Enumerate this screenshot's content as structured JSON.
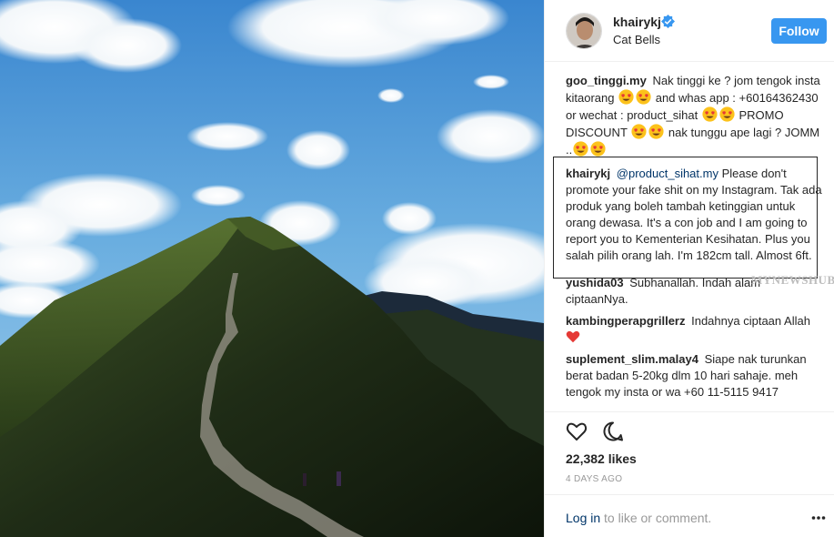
{
  "post": {
    "username": "khairykj",
    "location": "Cat Bells",
    "follow_label": "Follow",
    "verified_icon": "verified-badge-icon"
  },
  "comments": [
    {
      "author": "goo_tinggi.my",
      "text_1": "Nak tinggi ke ? jom tengok insta kitaorang",
      "text_2": "and whas app : +60164362430 or wechat : product_sihat",
      "text_3": "PROMO DISCOUNT",
      "text_4": "nak tunggu ape lagi ? JOMM ..",
      "emoji": "heart-eyes-emoji"
    },
    {
      "author": "khairykj",
      "mention": "@product_sihat.my",
      "text": "Please don't promote your fake shit on my Instagram. Tak ada produk yang boleh tambah ketinggian untuk orang dewasa. It's a con job and I am going to report you to Kementerian Kesihatan. Plus you salah pilih orang lah. I'm 182cm tall. Almost 6ft."
    },
    {
      "author": "yushida03",
      "text": "Subhanallah. Indah alam ciptaanNya."
    },
    {
      "author": "kambingperapgrillerz",
      "text": "Indahnya ciptaan Allah",
      "emoji": "red-heart-emoji"
    },
    {
      "author": "suplement_slim.malay4",
      "text": "Siape nak turunkan berat badan 5-20kg dlm 10 hari sahaje. meh tengok my insta or wa +60 11-5115 9417"
    }
  ],
  "watermark": "MYNEWSHUB",
  "stats": {
    "likes": "22,382 likes",
    "timestamp": "4 DAYS AGO"
  },
  "footer": {
    "login_label": "Log in",
    "rest_label": " to like or comment."
  },
  "colors": {
    "follow_button": "#3897f0",
    "link": "#003569",
    "muted": "#999999"
  }
}
